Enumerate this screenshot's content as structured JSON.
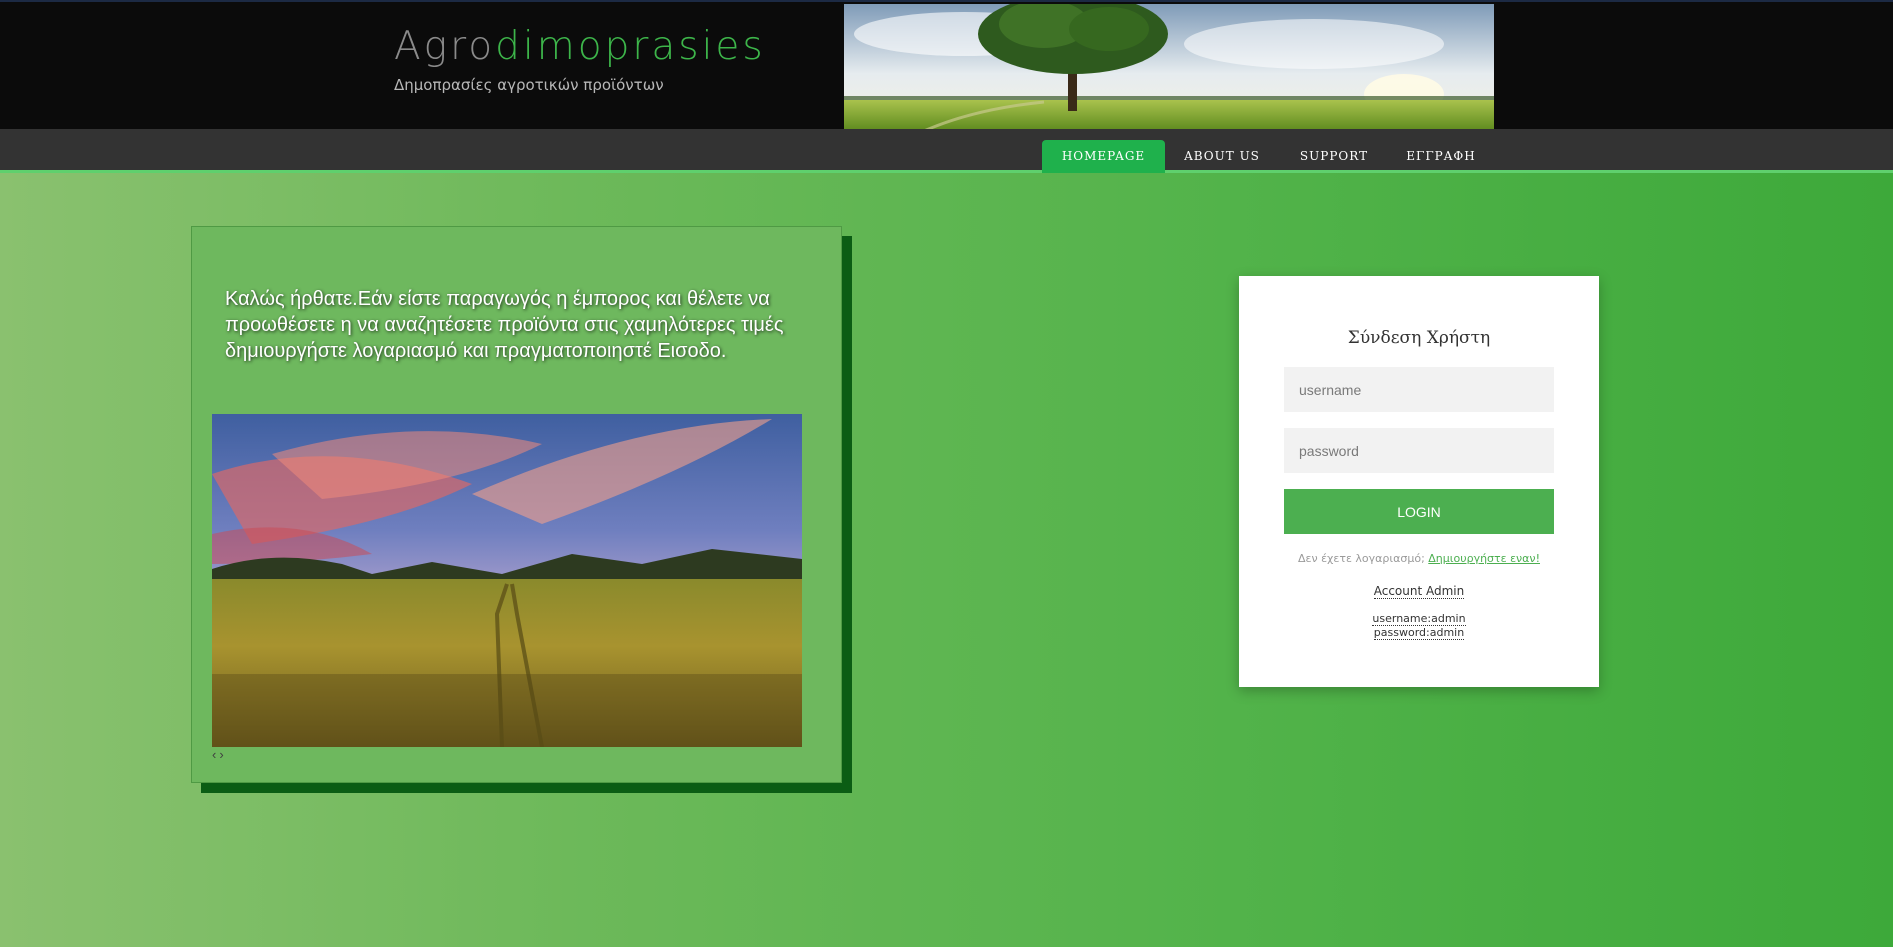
{
  "header": {
    "logo_part1": "Agro",
    "logo_part2": "dimoprasies",
    "tagline": "Δημοπρασίες αγροτικών προϊόντων"
  },
  "nav": {
    "items": [
      {
        "label": "HOMEPAGE",
        "active": true
      },
      {
        "label": "ABOUT US",
        "active": false
      },
      {
        "label": "SUPPORT",
        "active": false
      },
      {
        "label": "ΕΓΓΡΑΦΗ",
        "active": false
      }
    ]
  },
  "welcome": {
    "text": "Καλώς ήρθατε.Εάν είστε παραγωγός η έμπορος και θέλετε να προωθέσετε η να αναζητέσετε προϊόντα στις χαμηλότερες τιμές δημιουργήστε λογαριασμό και πραγματοποιηστέ Εισοδο.",
    "prev_arrow": "‹",
    "next_arrow": "›"
  },
  "login": {
    "title": "Σύνδεση Χρήστη",
    "username_placeholder": "username",
    "password_placeholder": "password",
    "button_label": "LOGIN",
    "no_account_text": "Δεν έχετε λογαριασμό;",
    "create_link": "Δημιουργήστε εναν!",
    "admin_label": "Account Admin",
    "admin_username": "username:admin",
    "admin_password": "password:admin"
  },
  "colors": {
    "accent": "#3db54a",
    "nav_active": "#1fb14c",
    "login_button": "#4caf50",
    "panel_shadow": "#0b5d14"
  }
}
